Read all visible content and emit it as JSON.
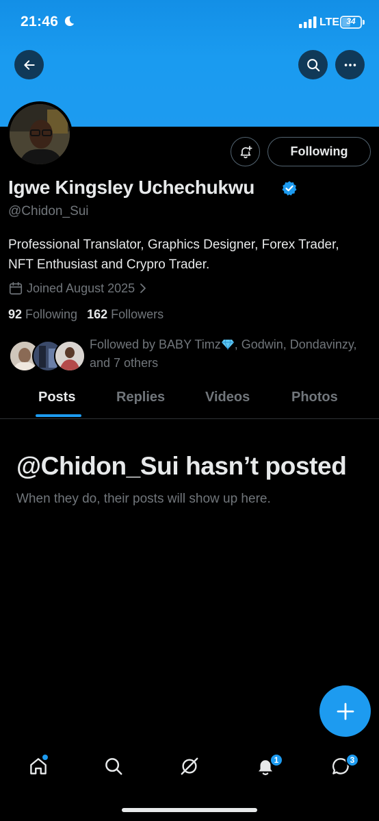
{
  "status_bar": {
    "time": "21:46",
    "network": "LTE",
    "battery": "34",
    "icons": [
      "moon-icon",
      "signal-icon",
      "battery-icon"
    ]
  },
  "header": {
    "banner_color": "#1d9bf0",
    "buttons": [
      "back-arrow-icon",
      "search-icon",
      "more-icon"
    ]
  },
  "profile": {
    "display_name": "Igwe Kingsley Uchechukwu",
    "verified": true,
    "handle": "@Chidon_Sui",
    "bio": "Professional Translator, Graphics Designer, Forex Trader, NFT Enthusiast and Crypro Trader.",
    "joined": "Joined August 2025",
    "following_count": "92",
    "following_label": "Following",
    "followers_count": "162",
    "followers_label": "Followers",
    "followed_by_prefix": "Followed by BABY Timz",
    "followed_by_suffix": ", Godwin, Dondavinzy, and 7 others",
    "follow_button_label": "Following"
  },
  "tabs": [
    {
      "label": "Posts",
      "active": true
    },
    {
      "label": "Replies",
      "active": false
    },
    {
      "label": "Videos",
      "active": false
    },
    {
      "label": "Photos",
      "active": false
    }
  ],
  "empty_state": {
    "title": "@Chidon_Sui hasn’t posted",
    "subtitle": "When they do, their posts will show up here."
  },
  "bottom_nav": {
    "items": [
      "home-icon",
      "search-icon",
      "grok-icon",
      "notifications-icon",
      "messages-icon"
    ],
    "notifications_badge": "1",
    "messages_badge": "3"
  },
  "colors": {
    "accent": "#1d9bf0",
    "background": "#000000",
    "text_primary": "#e7e9ea",
    "text_secondary": "#71767b"
  }
}
